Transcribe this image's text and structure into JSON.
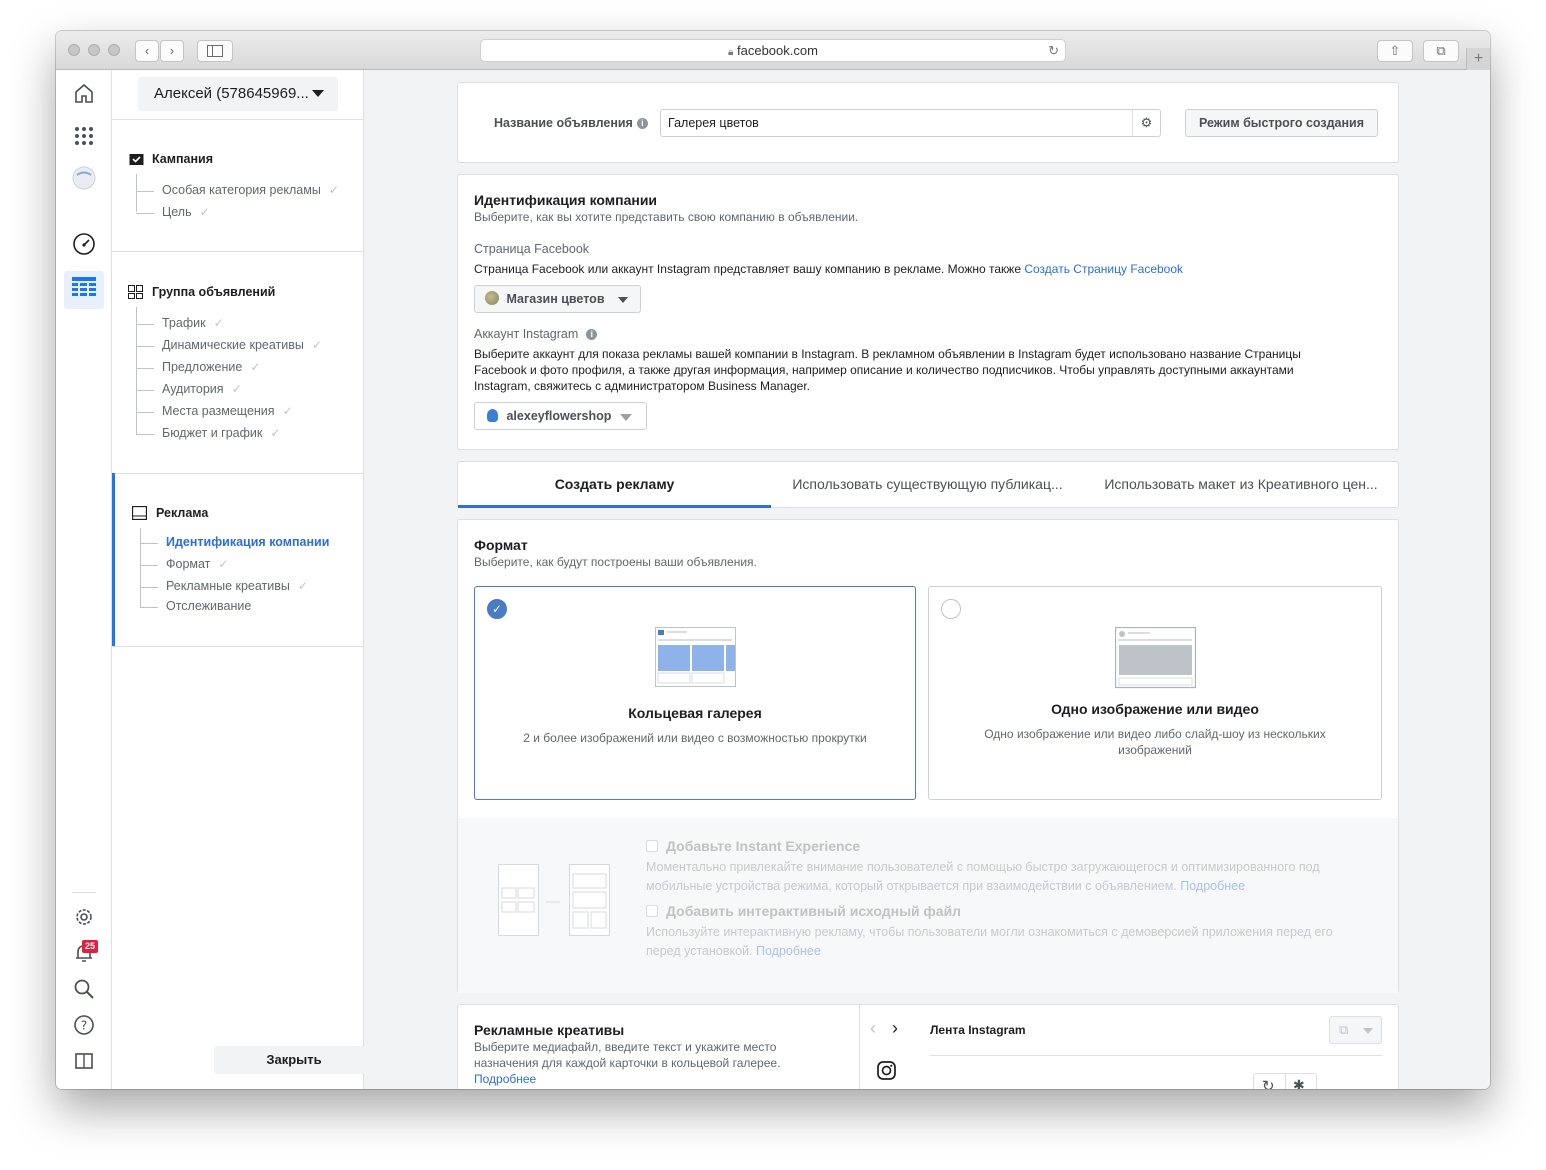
{
  "browser": {
    "url": "facebook.com",
    "new_tab": "+"
  },
  "nav": {
    "account": "Алексей (578645969...",
    "campaign": {
      "title": "Кампания",
      "items": [
        "Особая категория рекламы",
        "Цель"
      ]
    },
    "adset": {
      "title": "Группа объявлений",
      "items": [
        "Трафик",
        "Динамические креативы",
        "Предложение",
        "Аудитория",
        "Места размещения",
        "Бюджет и график"
      ]
    },
    "ad": {
      "title": "Реклама",
      "items": [
        "Идентификация компании",
        "Формат",
        "Рекламные креативы",
        "Отслеживание"
      ]
    },
    "close": "Закрыть"
  },
  "iconbar": {
    "notification_count": "25"
  },
  "adname": {
    "label": "Название объявления",
    "value": "Галерея цветов",
    "quick_mode": "Режим быстрого создания"
  },
  "identity": {
    "title": "Идентификация компании",
    "subtitle": "Выберите, как вы хотите представить свою компанию в объявлении.",
    "fb_label": "Страница Facebook",
    "fb_text": "Страница Facebook или аккаунт Instagram представляет вашу компанию в рекламе. Можно также",
    "fb_link": "Создать Страницу Facebook",
    "fb_page": "Магазин цветов",
    "ig_label": "Аккаунт Instagram",
    "ig_text_1": "Выберите аккаунт для показа рекламы вашей компании в Instagram. В рекламном объявлении в Instagram будет использовано название Страницы",
    "ig_text_2": "Facebook и фото профиля, а также другая информация, например описание и количество подписчиков. Чтобы управлять доступными аккаунтами",
    "ig_text_3": "Instagram, свяжитесь с администратором Business Manager.",
    "ig_account": "alexeyflowershop"
  },
  "tabs": [
    "Создать рекламу",
    "Использовать существующую публикац...",
    "Использовать макет из Креативного цен..."
  ],
  "format": {
    "title": "Формат",
    "subtitle": "Выберите, как будут построены ваши объявления.",
    "carousel_title": "Кольцевая галерея",
    "carousel_desc": "2 и более изображений или видео с возможностью прокрутки",
    "single_title": "Одно изображение или видео",
    "single_desc": "Одно изображение или видео либо слайд-шоу из нескольких изображений",
    "instant_title": "Добавьте Instant Experience",
    "instant_desc_1": "Моментально привлекайте внимание пользователей с помощью быстро загружающегося и оптимизированного под",
    "instant_desc_2": "мобильные устройства режима, который открывается при взаимодействии с объявлением.",
    "instant_link": "Подробнее",
    "playable_title": "Добавить интерактивный исходный файл",
    "playable_desc_1": "Используйте интерактивную рекламу, чтобы пользователи могли ознакомиться с демоверсией приложения перед его",
    "playable_desc_2": "перед установкой.",
    "playable_link": "Подробнее"
  },
  "creative": {
    "title": "Рекламные креативы",
    "desc_1": "Выберите медиафайл, введите текст и укажите место",
    "desc_2": "назначения для каждой карточки в кольцевой галерее.",
    "link": "Подробнее",
    "preview_label": "Лента Instagram"
  },
  "colors": {
    "accent": "#1877f2",
    "link": "#2d6fd6",
    "selected_border": "#4a7cc6",
    "badge": "#e41e3f"
  }
}
